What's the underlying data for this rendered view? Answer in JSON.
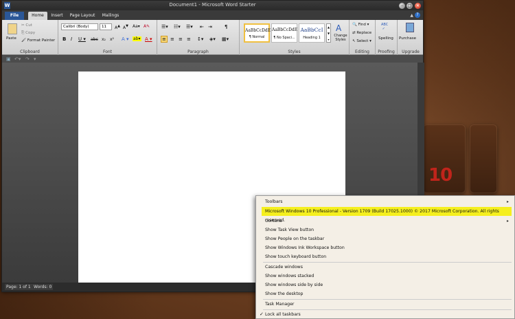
{
  "window": {
    "title": "Document1 - Microsoft Word Starter"
  },
  "tabs": {
    "file": "File",
    "home": "Home",
    "insert": "Insert",
    "page_layout": "Page Layout",
    "mailings": "Mailings"
  },
  "ribbon": {
    "clipboard": {
      "label": "Clipboard",
      "paste": "Paste",
      "cut": "Cut",
      "copy": "Copy",
      "format_painter": "Format Painter"
    },
    "font": {
      "label": "Font",
      "family": "Calibri (Body)",
      "size": "11"
    },
    "paragraph": {
      "label": "Paragraph"
    },
    "styles": {
      "label": "Styles",
      "items": [
        {
          "sample": "AaBbCcDdE",
          "name": "¶ Normal"
        },
        {
          "sample": "AaBbCcDdE",
          "name": "¶ No Spaci..."
        },
        {
          "sample": "AaBbCcI",
          "name": "Heading 1"
        }
      ],
      "change_styles": "Change Styles"
    },
    "editing": {
      "label": "Editing",
      "find": "Find",
      "replace": "Replace",
      "select": "Select"
    },
    "proofing": {
      "label": "Proofing",
      "spelling": "Spelling"
    },
    "upgrade": {
      "label": "Upgrade",
      "purchase": "Purchase"
    }
  },
  "status": {
    "page": "Page: 1 of 1",
    "words": "Words: 0"
  },
  "desktop": {
    "logo_text": "10"
  },
  "context_menu": {
    "toolbars": "Toolbars",
    "version": "Microsoft Windows 10 Professional - Version 1709 (Build 17025.1000) © 2017 Microsoft Corporation. All rights reserved.",
    "cortana": "Cortana",
    "task_view": "Show Task View button",
    "people": "Show People on the taskbar",
    "ink": "Show Windows Ink Workspace button",
    "touch_keyboard": "Show touch keyboard button",
    "cascade": "Cascade windows",
    "stacked": "Show windows stacked",
    "side_by_side": "Show windows side by side",
    "desktop": "Show the desktop",
    "task_manager": "Task Manager",
    "lock_taskbars": "Lock all taskbars"
  }
}
